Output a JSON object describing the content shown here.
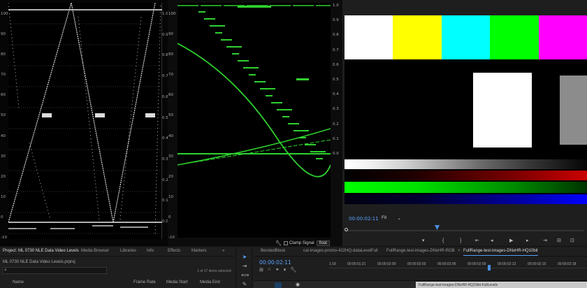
{
  "waveform_left": {
    "y_ticks": [
      "100",
      "90",
      "80",
      "70",
      "60",
      "50",
      "40",
      "30",
      "20",
      "10",
      "0",
      "-10"
    ],
    "right_ticks": [
      "1.0",
      "0.9",
      "0.8",
      "0.7",
      "0.6",
      "0.5",
      "0.4",
      "0.3",
      "0.2",
      "0.1",
      "0.0"
    ]
  },
  "waveform_mid": {
    "y_ticks": [
      "100",
      "90",
      "80",
      "70",
      "60",
      "50",
      "40",
      "30",
      "20",
      "10",
      "0",
      "-10"
    ],
    "right_ticks": [
      "1.0",
      "0.9",
      "0.8",
      "0.7",
      "0.6",
      "0.5",
      "0.4",
      "0.3",
      "0.2",
      "0.1",
      "0.0"
    ],
    "trace_color": "#2fd12f"
  },
  "scope_toolbar": {
    "clamp_signal": "Clamp Signal",
    "float": "float"
  },
  "program_monitor": {
    "timecode": "00:00:02:11",
    "zoom": "Fit",
    "color_bars": [
      "#ffffff",
      "#ffff00",
      "#00ffff",
      "#00ff00",
      "#ff00ff"
    ]
  },
  "project_panel": {
    "tabs": [
      "Project: ML 0730 NLE Data Video Levels",
      "Media Browser",
      "Libraries",
      "Info",
      "Effects",
      "Markers"
    ],
    "path": "ML 0730 NLE Data Video Levels.prproj",
    "items_selected": "1 of 17 items selected",
    "columns": [
      "Name",
      "Frame Rate",
      "Media Start",
      "Media End"
    ]
  },
  "timeline": {
    "tabs": [
      "BerstedBlock",
      "cal-images-promo-422HQ-dataLevelFull",
      "FullRange-test-images-DNxHR-RGB",
      "FullRange-test-images-DNxHR-HQ10bit"
    ],
    "timecode": "00:00:02:11",
    "ruler": [
      "1:18",
      "00:00:01:21",
      "00:00:02:00",
      "00:00:02:03",
      "00:00:02:06",
      "00:00:02:09",
      "00:00:02:12",
      "00:00:02:15",
      "00:00:02:18"
    ],
    "clip_label": "FullRange-test-images-DNxHR-HQ10bit-FullLevels"
  }
}
